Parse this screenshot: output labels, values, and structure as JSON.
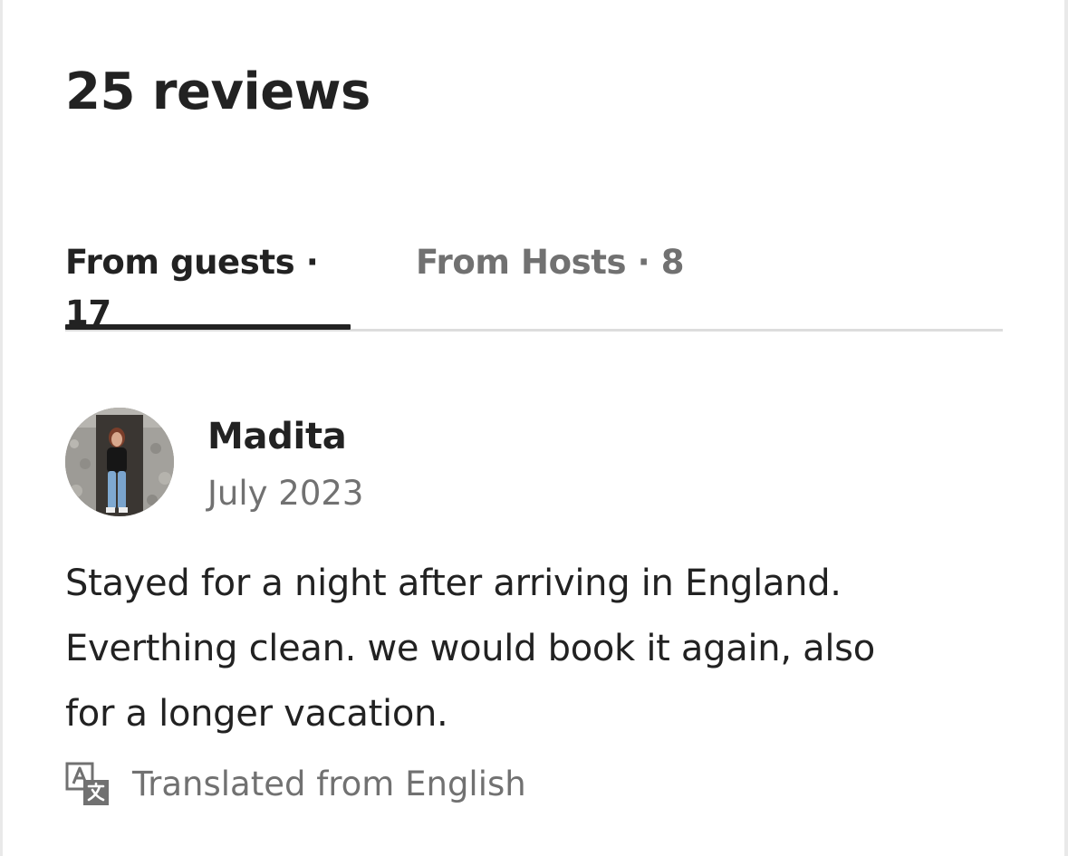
{
  "heading": "25 reviews",
  "tabs": [
    {
      "label": "From guests · 17",
      "active": true
    },
    {
      "label": "From Hosts · 8",
      "active": false
    }
  ],
  "review": {
    "reviewer_name": "Madita",
    "date": "July 2023",
    "text_lines": [
      "Stayed for a night after arriving in England.",
      "Everthing clean. we would book it again, also",
      "for a longer vacation."
    ],
    "translation_label": "Translated from English",
    "translation_icon": "translate-icon",
    "avatar_icon": "avatar-photo"
  },
  "colors": {
    "primary_text": "#222222",
    "secondary_text": "#717171",
    "divider": "#dddddd"
  }
}
